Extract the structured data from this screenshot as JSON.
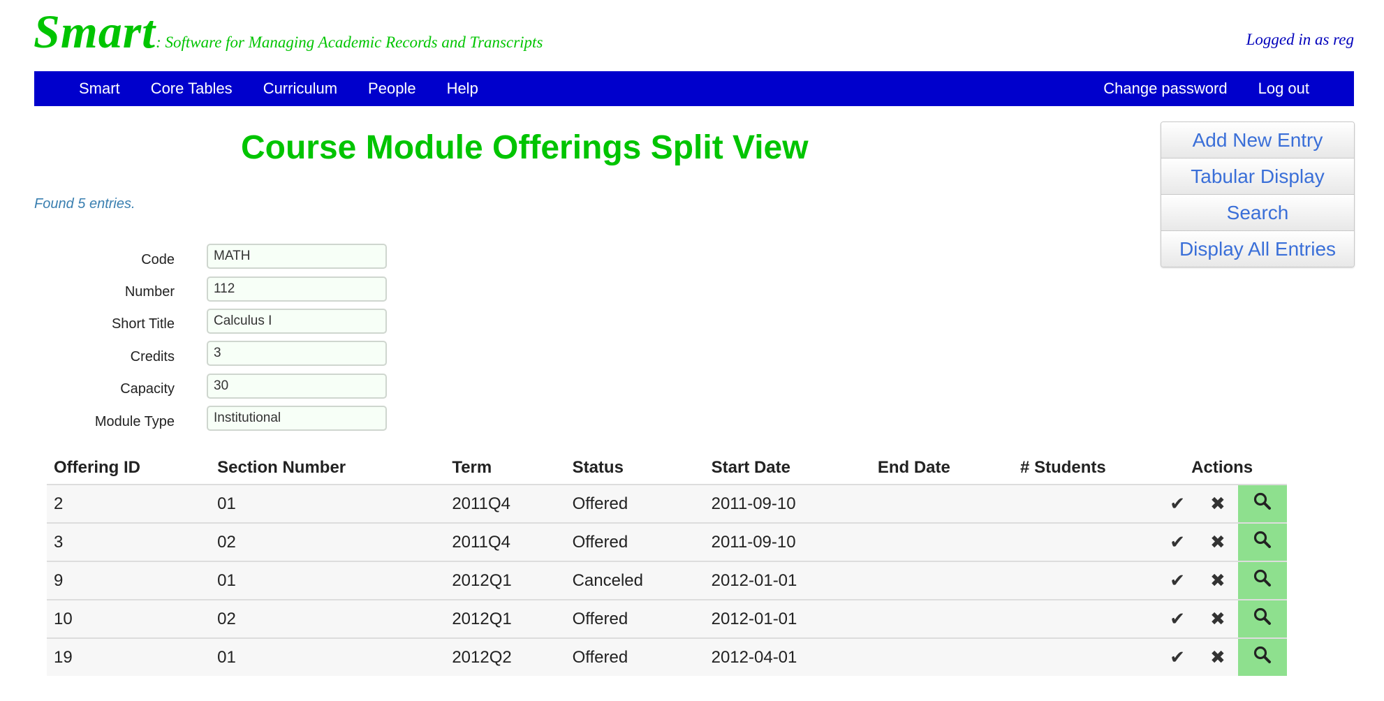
{
  "header": {
    "brand": "Smart",
    "tagline": ": Software for Managing Academic Records and Transcripts",
    "logged_in": "Logged in as reg"
  },
  "nav": {
    "left": [
      "Smart",
      "Core Tables",
      "Curriculum",
      "People",
      "Help"
    ],
    "right": [
      "Change password",
      "Log out"
    ]
  },
  "page": {
    "title": "Course Module Offerings Split View",
    "found": "Found 5 entries."
  },
  "side_buttons": [
    "Add New Entry",
    "Tabular Display",
    "Search",
    "Display All Entries"
  ],
  "form": {
    "fields": [
      {
        "label": "Code",
        "value": "MATH"
      },
      {
        "label": "Number",
        "value": "112"
      },
      {
        "label": "Short Title",
        "value": "Calculus I"
      },
      {
        "label": "Credits",
        "value": "3"
      },
      {
        "label": "Capacity",
        "value": "30"
      },
      {
        "label": "Module Type",
        "value": "Institutional"
      }
    ]
  },
  "table": {
    "headers": [
      "Offering ID",
      "Section Number",
      "Term",
      "Status",
      "Start Date",
      "End Date",
      "# Students",
      "Actions"
    ],
    "rows": [
      {
        "id": "2",
        "section": "01",
        "term": "2011Q4",
        "status": "Offered",
        "start": "2011-09-10",
        "end": "",
        "students": ""
      },
      {
        "id": "3",
        "section": "02",
        "term": "2011Q4",
        "status": "Offered",
        "start": "2011-09-10",
        "end": "",
        "students": ""
      },
      {
        "id": "9",
        "section": "01",
        "term": "2012Q1",
        "status": "Canceled",
        "start": "2012-01-01",
        "end": "",
        "students": ""
      },
      {
        "id": "10",
        "section": "02",
        "term": "2012Q1",
        "status": "Offered",
        "start": "2012-01-01",
        "end": "",
        "students": ""
      },
      {
        "id": "19",
        "section": "01",
        "term": "2012Q2",
        "status": "Offered",
        "start": "2012-04-01",
        "end": "",
        "students": ""
      }
    ],
    "action_icons": {
      "edit": "✔",
      "delete": "✖",
      "view": "search-icon"
    }
  },
  "colors": {
    "brand_green": "#00c400",
    "nav_blue": "#0000cc",
    "view_green": "#8ee08e"
  }
}
